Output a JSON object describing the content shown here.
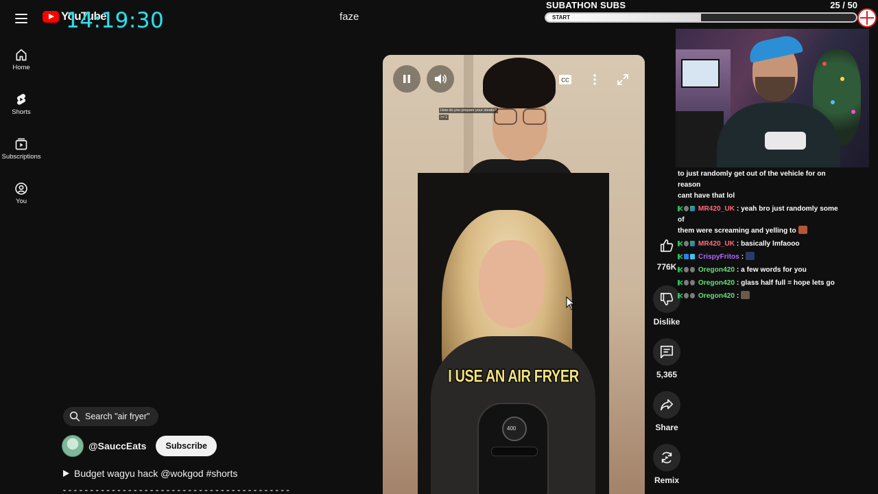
{
  "app": {
    "logo_text": "YouTube"
  },
  "overlay": {
    "clock": "14:19:30",
    "subathon_title": "SUBATHON SUBS",
    "subathon_count": "25 / 50",
    "subathon_start": "START",
    "subathon_progress": 0.5
  },
  "search": {
    "query": "faze"
  },
  "nav": {
    "items": [
      {
        "label": "Home",
        "icon": "home-icon"
      },
      {
        "label": "Shorts",
        "icon": "shorts-icon"
      },
      {
        "label": "Subscriptions",
        "icon": "subscriptions-icon"
      },
      {
        "label": "You",
        "icon": "you-icon"
      }
    ]
  },
  "player": {
    "caption": "I USE AN AIR FRYER",
    "question_text": "How do you prepare your steaks?",
    "question_sub": ">> 1",
    "fryer_display": "400"
  },
  "short": {
    "search_chip": "Search \"air fryer\"",
    "channel": "@SauccEats",
    "subscribe_label": "Subscribe",
    "title": "Budget wagyu hack @wokgod #shorts"
  },
  "actions": {
    "like_count": "776K",
    "dislike_label": "Dislike",
    "comment_count": "5,365",
    "share_label": "Share",
    "remix_label": "Remix"
  },
  "chat": {
    "partial_line_1": "to just randomly get out of the vehicle for on reason",
    "partial_line_2": "cant have that lol",
    "messages": [
      {
        "user": "MR420_UK",
        "text": ": yeah bro just randomly some of",
        "text2": "them were screaming and yelling to",
        "color": "#ff6b7a"
      },
      {
        "user": "MR420_UK",
        "text": ": basically lmfaooo",
        "color": "#ff6b7a"
      },
      {
        "user": "CrispyFritos",
        "text": ":",
        "color": "#b466ff"
      },
      {
        "user": "Oregon420",
        "text": ": a few words for you",
        "color": "#67e07a"
      },
      {
        "user": "Oregon420",
        "text": ": glass half full = hope lets go",
        "color": "#67e07a"
      },
      {
        "user": "Oregon420",
        "text": ":",
        "color": "#67e07a"
      }
    ]
  },
  "colors": {
    "background": "#0f0f0f",
    "clock": "#32dbe6",
    "brand_red": "#ff0000",
    "caption": "#f2e27b"
  }
}
